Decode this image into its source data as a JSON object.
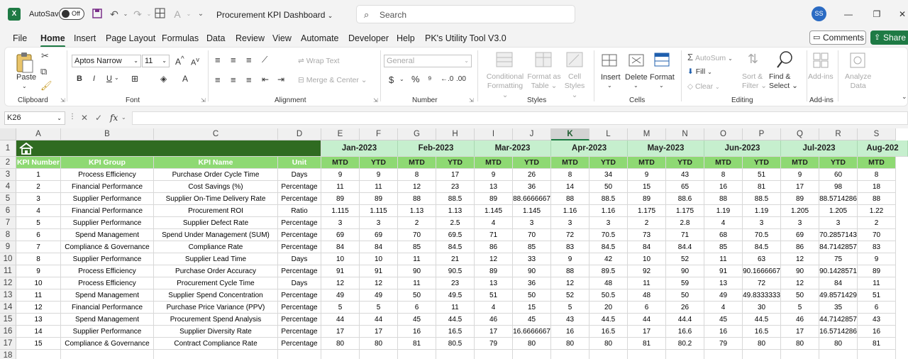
{
  "app": {
    "logo": "X",
    "autosave_label": "AutoSave",
    "autosave_state": "Off",
    "doc_title": "Procurement KPI Dashboard",
    "search_placeholder": "Search",
    "user_initials": "SS"
  },
  "menu": [
    "File",
    "Home",
    "Insert",
    "Page Layout",
    "Formulas",
    "Data",
    "Review",
    "View",
    "Automate",
    "Developer",
    "Help",
    "PK's Utility Tool V3.0"
  ],
  "actions": {
    "comments": "Comments",
    "share": "Share"
  },
  "ribbon": {
    "clipboard": {
      "label": "Clipboard",
      "paste": "Paste"
    },
    "font": {
      "label": "Font",
      "name": "Aptos Narrow",
      "size": "11"
    },
    "alignment": {
      "label": "Alignment",
      "wrap": "Wrap Text",
      "merge": "Merge & Center"
    },
    "number": {
      "label": "Number",
      "format": "General"
    },
    "styles": {
      "label": "Styles",
      "cond1": "Conditional",
      "cond2": "Formatting",
      "fmt1": "Format as",
      "fmt2": "Table",
      "cell1": "Cell",
      "cell2": "Styles"
    },
    "cells": {
      "label": "Cells",
      "insert": "Insert",
      "delete": "Delete",
      "format": "Format"
    },
    "editing": {
      "label": "Editing",
      "autosum": "AutoSum",
      "fill": "Fill",
      "clear": "Clear",
      "sort1": "Sort &",
      "sort2": "Filter",
      "find1": "Find &",
      "find2": "Select"
    },
    "addins": {
      "label": "Add-ins",
      "btn": "Add-ins"
    },
    "analyze": {
      "btn1": "Analyze",
      "btn2": "Data"
    }
  },
  "formula_bar": {
    "cell_ref": "K26",
    "fx": "fx",
    "value": ""
  },
  "grid": {
    "columns": [
      "A",
      "B",
      "C",
      "D",
      "E",
      "F",
      "G",
      "H",
      "I",
      "J",
      "K",
      "L",
      "M",
      "N",
      "O",
      "P",
      "Q",
      "R",
      "S"
    ],
    "selected_column": "K",
    "row_numbers": [
      "1",
      "2",
      "3",
      "4",
      "5",
      "6",
      "7",
      "8",
      "9",
      "10",
      "11",
      "12",
      "13",
      "14",
      "15",
      "16",
      "17",
      "18"
    ],
    "months": [
      "Jan-2023",
      "Feb-2023",
      "Mar-2023",
      "Apr-2023",
      "May-2023",
      "Jun-2023",
      "Jul-2023",
      "Aug-202"
    ],
    "headers": [
      "KPI Number",
      "KPI Group",
      "KPI Name",
      "Unit",
      "MTD",
      "YTD",
      "MTD",
      "YTD",
      "MTD",
      "YTD",
      "MTD",
      "YTD",
      "MTD",
      "YTD",
      "MTD",
      "YTD",
      "MTD",
      "YTD",
      "MTD"
    ],
    "rows": [
      [
        "1",
        "Process Efficiency",
        "Purchase Order Cycle Time",
        "Days",
        "9",
        "9",
        "8",
        "17",
        "9",
        "26",
        "8",
        "34",
        "9",
        "43",
        "8",
        "51",
        "9",
        "60",
        "8"
      ],
      [
        "2",
        "Financial Performance",
        "Cost Savings (%)",
        "Percentage",
        "11",
        "11",
        "12",
        "23",
        "13",
        "36",
        "14",
        "50",
        "15",
        "65",
        "16",
        "81",
        "17",
        "98",
        "18"
      ],
      [
        "3",
        "Supplier Performance",
        "Supplier On-Time Delivery Rate",
        "Percentage",
        "89",
        "89",
        "88",
        "88.5",
        "89",
        "88.6666667",
        "88",
        "88.5",
        "89",
        "88.6",
        "88",
        "88.5",
        "89",
        "88.5714286",
        "88"
      ],
      [
        "4",
        "Financial Performance",
        "Procurement ROI",
        "Ratio",
        "1.115",
        "1.115",
        "1.13",
        "1.13",
        "1.145",
        "1.145",
        "1.16",
        "1.16",
        "1.175",
        "1.175",
        "1.19",
        "1.19",
        "1.205",
        "1.205",
        "1.22"
      ],
      [
        "5",
        "Supplier Performance",
        "Supplier Defect Rate",
        "Percentage",
        "3",
        "3",
        "2",
        "2.5",
        "4",
        "3",
        "3",
        "3",
        "2",
        "2.8",
        "4",
        "3",
        "3",
        "3",
        "2"
      ],
      [
        "6",
        "Spend Management",
        "Spend Under Management (SUM)",
        "Percentage",
        "69",
        "69",
        "70",
        "69.5",
        "71",
        "70",
        "72",
        "70.5",
        "73",
        "71",
        "68",
        "70.5",
        "69",
        "70.2857143",
        "70"
      ],
      [
        "7",
        "Compliance & Governance",
        "Compliance Rate",
        "Percentage",
        "84",
        "84",
        "85",
        "84.5",
        "86",
        "85",
        "83",
        "84.5",
        "84",
        "84.4",
        "85",
        "84.5",
        "86",
        "84.7142857",
        "83"
      ],
      [
        "8",
        "Supplier Performance",
        "Supplier Lead Time",
        "Days",
        "10",
        "10",
        "11",
        "21",
        "12",
        "33",
        "9",
        "42",
        "10",
        "52",
        "11",
        "63",
        "12",
        "75",
        "9"
      ],
      [
        "9",
        "Process Efficiency",
        "Purchase Order Accuracy",
        "Percentage",
        "91",
        "91",
        "90",
        "90.5",
        "89",
        "90",
        "88",
        "89.5",
        "92",
        "90",
        "91",
        "90.1666667",
        "90",
        "90.1428571",
        "89"
      ],
      [
        "10",
        "Process Efficiency",
        "Procurement Cycle Time",
        "Days",
        "12",
        "12",
        "11",
        "23",
        "13",
        "36",
        "12",
        "48",
        "11",
        "59",
        "13",
        "72",
        "12",
        "84",
        "11"
      ],
      [
        "11",
        "Spend Management",
        "Supplier Spend Concentration",
        "Percentage",
        "49",
        "49",
        "50",
        "49.5",
        "51",
        "50",
        "52",
        "50.5",
        "48",
        "50",
        "49",
        "49.8333333",
        "50",
        "49.8571429",
        "51"
      ],
      [
        "12",
        "Financial Performance",
        "Purchase Price Variance (PPV)",
        "Percentage",
        "5",
        "5",
        "6",
        "11",
        "4",
        "15",
        "5",
        "20",
        "6",
        "26",
        "4",
        "30",
        "5",
        "35",
        "6"
      ],
      [
        "13",
        "Spend Management",
        "Procurement Spend Analysis",
        "Percentage",
        "44",
        "44",
        "45",
        "44.5",
        "46",
        "45",
        "43",
        "44.5",
        "44",
        "44.4",
        "45",
        "44.5",
        "46",
        "44.7142857",
        "43"
      ],
      [
        "14",
        "Supplier Performance",
        "Supplier Diversity Rate",
        "Percentage",
        "17",
        "17",
        "16",
        "16.5",
        "17",
        "16.6666667",
        "16",
        "16.5",
        "17",
        "16.6",
        "16",
        "16.5",
        "17",
        "16.5714286",
        "16"
      ],
      [
        "15",
        "Compliance & Governance",
        "Contract Compliance Rate",
        "Percentage",
        "80",
        "80",
        "81",
        "80.5",
        "79",
        "80",
        "80",
        "80",
        "81",
        "80.2",
        "79",
        "80",
        "80",
        "80",
        "81"
      ]
    ]
  },
  "colors": {
    "accent": "#1e7a44",
    "title_band": "#2f6b21",
    "header_row": "#8ed973",
    "month_band": "#c6efce"
  },
  "icons": [
    "excel-logo-icon",
    "save-icon",
    "undo-icon",
    "redo-icon",
    "table-icon",
    "font-color-icon",
    "search-icon",
    "home-icon"
  ]
}
